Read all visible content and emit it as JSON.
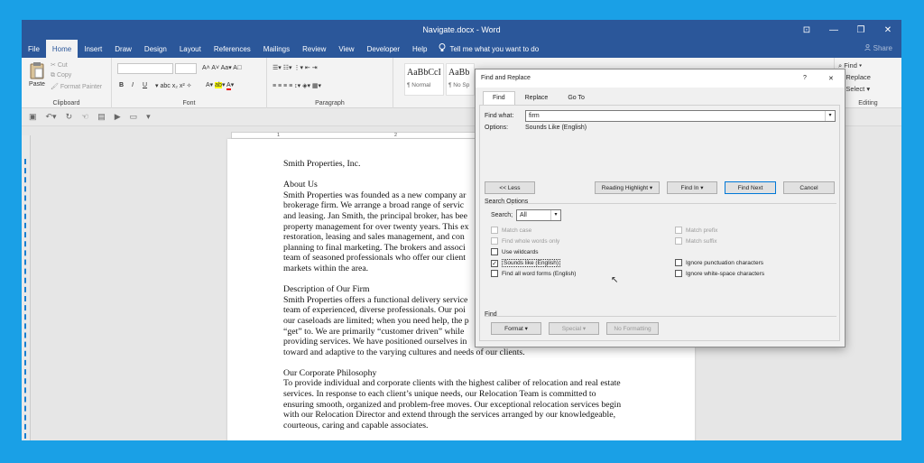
{
  "window": {
    "title": "Navigate.docx - Word",
    "controls": [
      "⊡",
      "—",
      "❐",
      "✕"
    ]
  },
  "ribbon_tabs": [
    "File",
    "Home",
    "Insert",
    "Draw",
    "Design",
    "Layout",
    "References",
    "Mailings",
    "Review",
    "View",
    "Developer",
    "Help"
  ],
  "tell_me": "Tell me what you want to do",
  "share": "Share",
  "clipboard": {
    "paste": "Paste",
    "cut": "Cut",
    "copy": "Copy",
    "format_painter": "Format Painter",
    "group": "Clipboard"
  },
  "font": {
    "group": "Font",
    "bold": "B",
    "italic": "I",
    "underline": "U"
  },
  "paragraph": {
    "group": "Paragraph"
  },
  "styles": [
    {
      "sample": "AaBbCcI",
      "name": "¶ Normal"
    },
    {
      "sample": "AaBb",
      "name": "¶ No Sp"
    }
  ],
  "editing": {
    "find": "Find",
    "replace": "Replace",
    "select": "Select",
    "group": "Editing"
  },
  "ruler": {
    "marks": [
      "1",
      "2",
      "3"
    ]
  },
  "document": {
    "paragraphs": [
      [
        "Smith Properties, Inc."
      ],
      [
        "About Us",
        "Smith Properties was founded as a new company ar",
        "brokerage firm. We arrange a broad range of servic",
        "and leasing. Jan Smith, the principal broker, has bee",
        "property management for over twenty years. This ex",
        "restoration, leasing and sales management, and con",
        "planning to final marketing. The brokers and associ",
        "team of seasoned professionals who offer our client",
        "markets within the area."
      ],
      [
        "Description of Our Firm",
        "Smith Properties offers a functional delivery service",
        "team of experienced, diverse professionals. Our poi",
        "our caseloads are limited; when you need help, the p",
        "“get” to. We are primarily “customer driven” while",
        "providing services. We have positioned ourselves in",
        "toward and adaptive to the varying cultures and needs of our clients."
      ],
      [
        "Our Corporate Philosophy",
        "To provide individual and corporate clients with the highest caliber of relocation and real estate",
        "services. In response to each client’s unique needs, our Relocation Team is committed to",
        "ensuring smooth, organized and problem-free moves. Our exceptional relocation services begin",
        "with our Relocation Director and extend through the services arranged by our knowledgeable,",
        "courteous, caring and capable associates."
      ]
    ]
  },
  "dialog": {
    "title": "Find and Replace",
    "help": "?",
    "close": "✕",
    "tabs": [
      "Find",
      "Replace",
      "Go To"
    ],
    "find_what_label": "Find what:",
    "find_what_value": "firm",
    "options_label": "Options:",
    "options_value": "Sounds Like (English)",
    "less_btn": "<< Less",
    "reading_highlight_btn": "Reading Highlight ▾",
    "find_in_btn": "Find In ▾",
    "find_next_btn": "Find Next",
    "cancel_btn": "Cancel",
    "search_options_label": "Search Options",
    "search_label": "Search;",
    "search_value": "All",
    "checkboxes_left": [
      {
        "label": "Match case",
        "checked": false,
        "enabled": false
      },
      {
        "label": "Find whole words only",
        "checked": false,
        "enabled": false
      },
      {
        "label": "Use wildcards",
        "checked": false,
        "enabled": true
      },
      {
        "label": "Sounds like (English)",
        "checked": true,
        "enabled": true
      },
      {
        "label": "Find all word forms (English)",
        "checked": false,
        "enabled": true
      }
    ],
    "checkboxes_right": [
      {
        "label": "Match prefix",
        "checked": false,
        "enabled": false
      },
      {
        "label": "Match suffix",
        "checked": false,
        "enabled": false
      },
      {
        "label": "Ignore punctuation characters",
        "checked": false,
        "enabled": true
      },
      {
        "label": "Ignore white-space characters",
        "checked": false,
        "enabled": true
      }
    ],
    "find_section_label": "Find",
    "format_btn": "Format ▾",
    "special_btn": "Special ▾",
    "no_formatting_btn": "No Formatting"
  }
}
